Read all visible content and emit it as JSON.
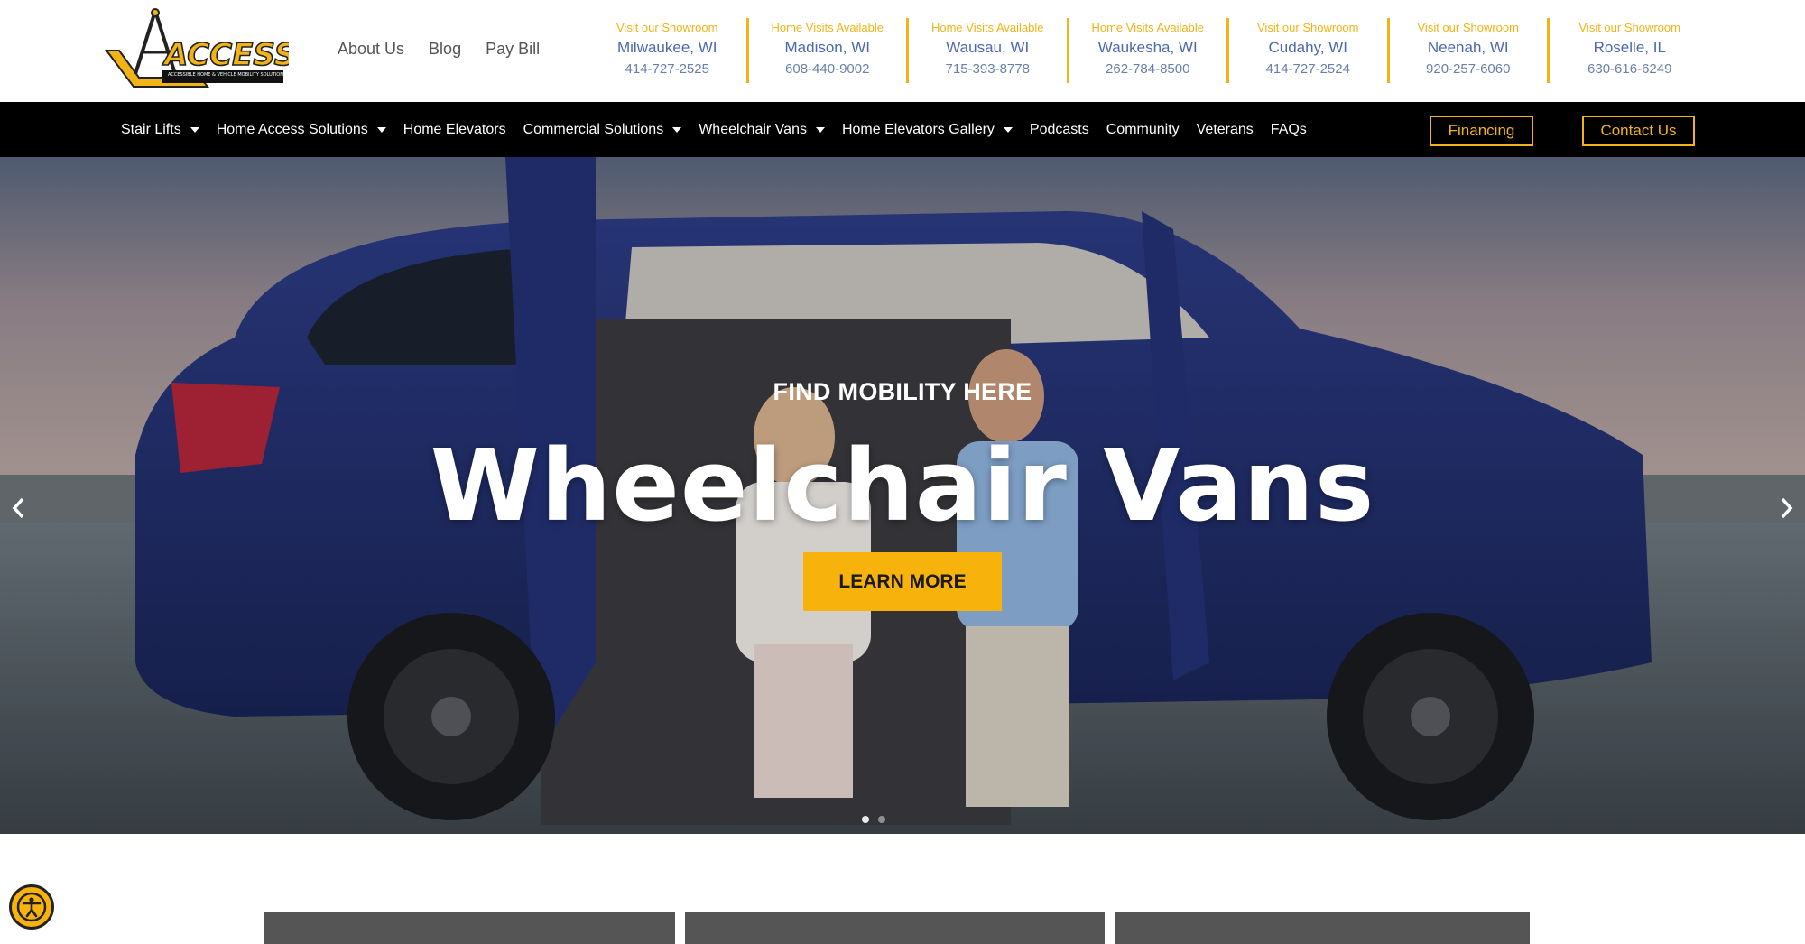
{
  "brand": {
    "logo_text": "ACCESS",
    "logo_tagline": "ACCESSIBLE HOME & VEHICLE MOBILITY SOLUTIONS",
    "accent_color": "#f2b318",
    "nav_bg": "#000000",
    "link_blue": "#4a69b0"
  },
  "top_links": [
    "About Us",
    "Blog",
    "Pay Bill"
  ],
  "locations": [
    {
      "tag": "Visit our Showroom",
      "city": "Milwaukee, WI",
      "phone": "414-727-2525"
    },
    {
      "tag": "Home Visits Available",
      "city": "Madison, WI",
      "phone": "608-440-9002"
    },
    {
      "tag": "Home Visits Available",
      "city": "Wausau, WI",
      "phone": "715-393-8778"
    },
    {
      "tag": "Home Visits Available",
      "city": "Waukesha, WI",
      "phone": "262-784-8500"
    },
    {
      "tag": "Visit our Showroom",
      "city": "Cudahy, WI",
      "phone": "414-727-2524"
    },
    {
      "tag": "Visit our Showroom",
      "city": "Neenah, WI",
      "phone": "920-257-6060"
    },
    {
      "tag": "Visit our Showroom",
      "city": "Roselle, IL",
      "phone": "630-616-6249"
    }
  ],
  "nav": {
    "items": [
      {
        "label": "Stair Lifts",
        "dropdown": true
      },
      {
        "label": "Home Access Solutions",
        "dropdown": true
      },
      {
        "label": "Home Elevators",
        "dropdown": false
      },
      {
        "label": "Commercial Solutions",
        "dropdown": true
      },
      {
        "label": "Wheelchair Vans",
        "dropdown": true
      },
      {
        "label": "Home Elevators Gallery",
        "dropdown": true
      },
      {
        "label": "Podcasts",
        "dropdown": false
      },
      {
        "label": "Community",
        "dropdown": false
      },
      {
        "label": "Veterans",
        "dropdown": false
      },
      {
        "label": "FAQs",
        "dropdown": false
      }
    ],
    "financing_label": "Financing",
    "contact_label": "Contact Us"
  },
  "hero": {
    "subtitle": "FIND MOBILITY HERE",
    "title": "Wheelchair Vans",
    "button_label": "LEARN MORE",
    "button_color": "#f7b20b",
    "slides_count": 2,
    "active_slide": 1
  },
  "accessibility": {
    "icon": "accessibility-person-icon"
  }
}
